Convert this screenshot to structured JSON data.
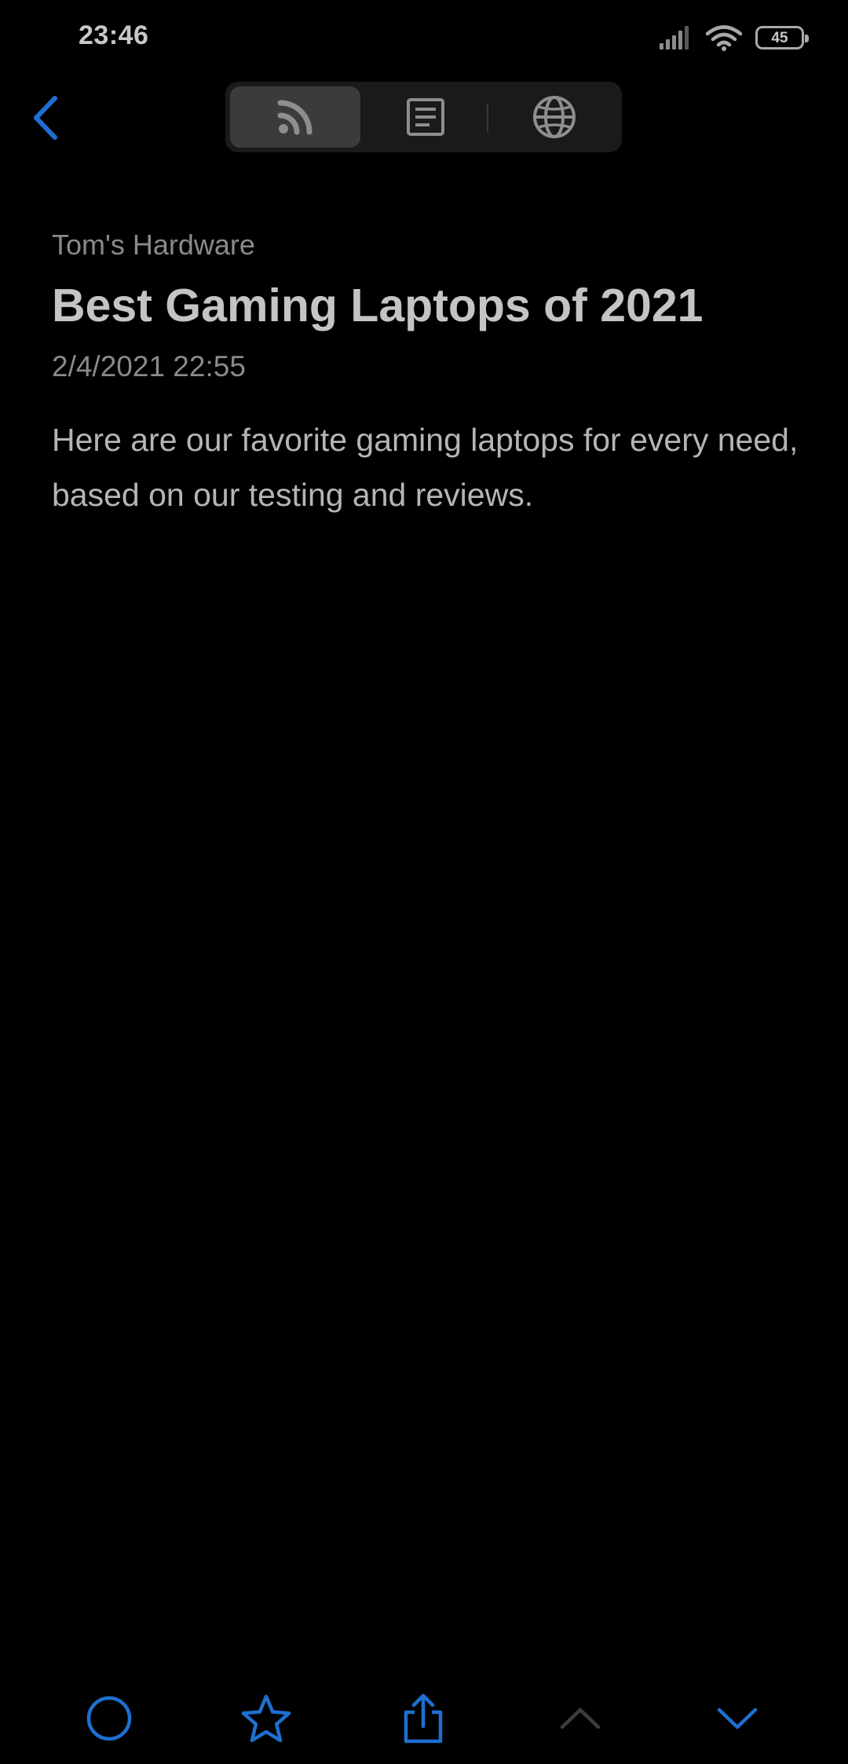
{
  "status_bar": {
    "time": "23:46",
    "battery_level": "45",
    "signal_icon": "cellular-signal-icon",
    "wifi_icon": "wifi-icon"
  },
  "nav": {
    "back_icon": "chevron-left-icon",
    "segments": [
      {
        "name": "feed",
        "icon": "rss-icon",
        "selected": true
      },
      {
        "name": "reader",
        "icon": "article-icon",
        "selected": false
      },
      {
        "name": "web",
        "icon": "globe-icon",
        "selected": false
      }
    ]
  },
  "article": {
    "source": "Tom's Hardware",
    "title": "Best Gaming Laptops of 2021",
    "date": "2/4/2021 22:55",
    "summary": "Here are our favorite gaming laptops for every need, based on our testing and reviews."
  },
  "toolbar": {
    "items": [
      {
        "name": "mark-read",
        "icon": "circle-icon"
      },
      {
        "name": "star",
        "icon": "star-icon"
      },
      {
        "name": "share",
        "icon": "share-icon"
      },
      {
        "name": "previous",
        "icon": "chevron-up-icon",
        "enabled": false
      },
      {
        "name": "next",
        "icon": "chevron-down-icon",
        "enabled": true
      }
    ]
  },
  "colors": {
    "background": "#000000",
    "accent": "#1e6fd0",
    "disabled": "#3d3d3d",
    "title_text": "#c4c4c4",
    "secondary_text": "#8a8a8a"
  }
}
